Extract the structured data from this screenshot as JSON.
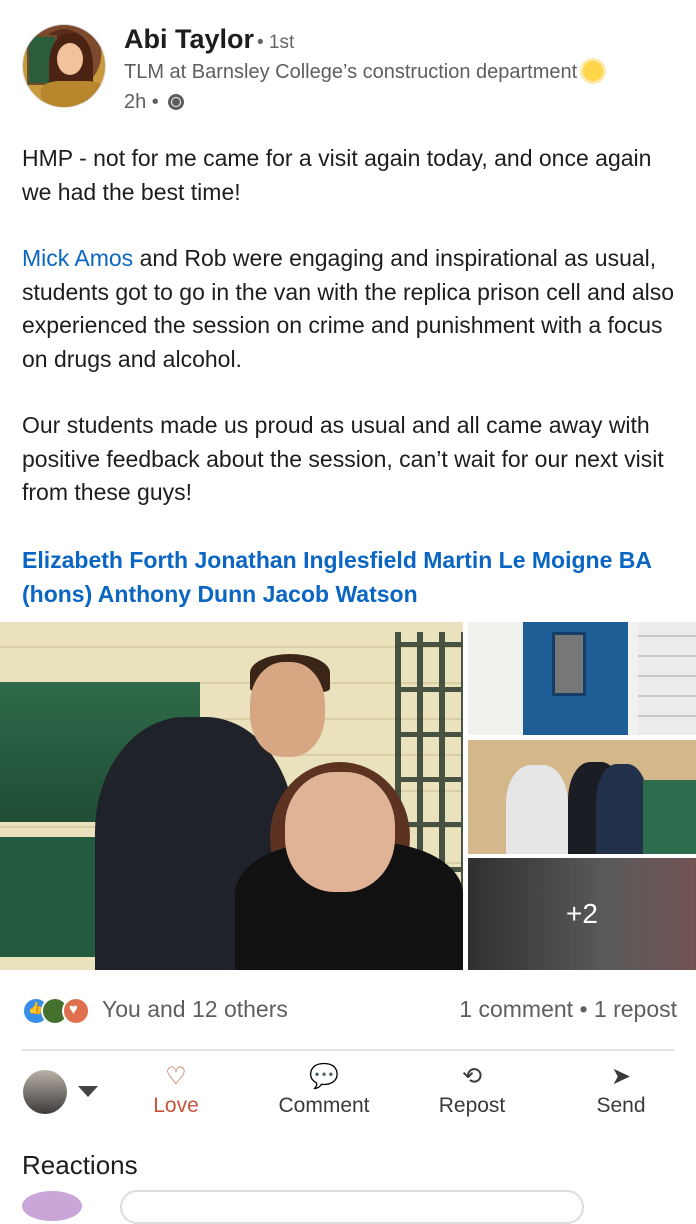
{
  "author": {
    "name": "Abi Taylor",
    "degree": "• 1st",
    "headline": "TLM at Barnsley College’s construction department",
    "time": "2h •",
    "avatar_icon": "profile-avatar-illustration",
    "visibility_icon": "globe-icon"
  },
  "post": {
    "para1": "HMP - not for me came for a visit again today, and once again we had the best time!",
    "mention1": "Mick Amos",
    "para2_rest": " and Rob were engaging and inspirational as usual, students got to go in the van with the replica prison cell and also experienced the session on crime and punishment with a focus on drugs and alcohol.",
    "para3": "Our students made us proud as usual and all came away with positive feedback about the session, can’t wait for our next visit from these guys!",
    "tags": "Elizabeth Forth Jonathan Inglesfield Martin Le Moigne BA (hons) Anthony Dunn Jacob Watson"
  },
  "photos": {
    "more_count": "+2"
  },
  "social": {
    "reactions_text": "You and 12 others",
    "counts_text": "1 comment • 1 repost",
    "reaction_icons": [
      "like-icon",
      "celebrate-icon",
      "love-icon"
    ],
    "colors": {
      "like": "#378fe9",
      "celebrate": "#44712e",
      "love": "#df704d"
    }
  },
  "actions": {
    "love": "Love",
    "comment": "Comment",
    "repost": "Repost",
    "send": "Send"
  },
  "reactions_heading": "Reactions"
}
